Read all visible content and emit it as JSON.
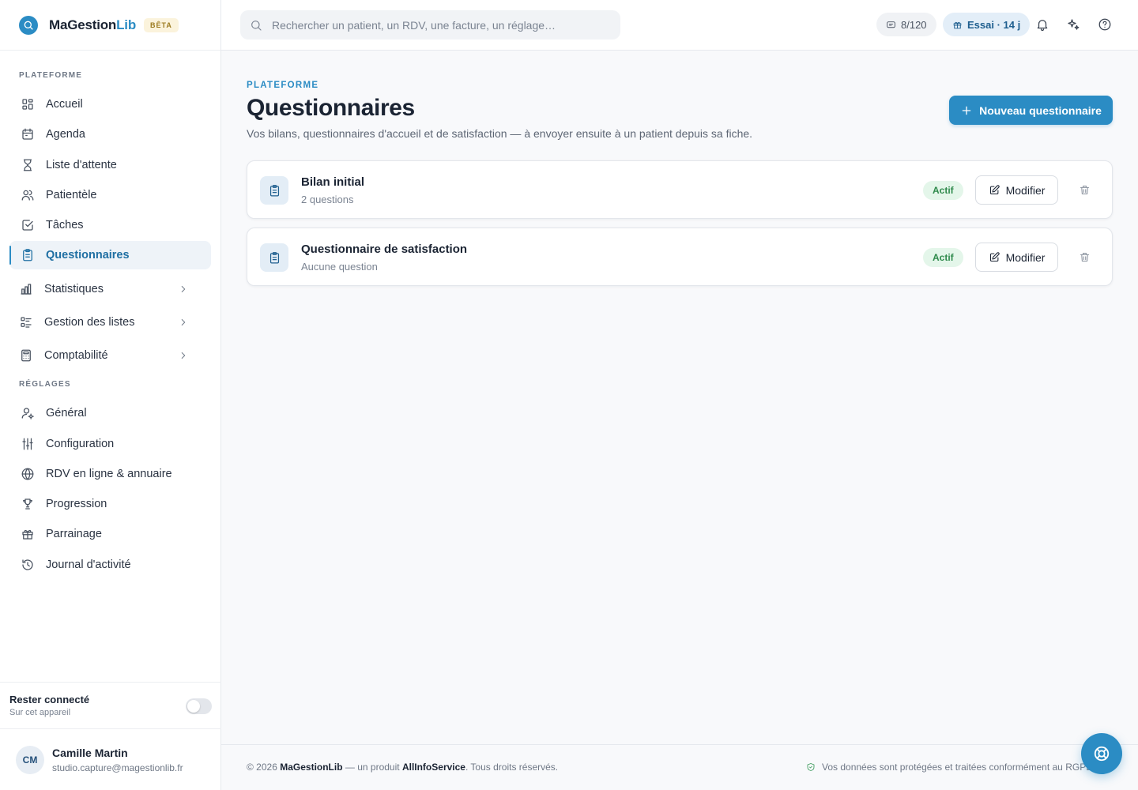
{
  "brand": {
    "name_main": "MaGestion",
    "name_accent": "Lib",
    "badge": "BÊTA"
  },
  "sidebar": {
    "sections": {
      "platform": "PLATEFORME",
      "settings": "RÉGLAGES"
    },
    "platform_items": [
      {
        "label": "Accueil",
        "icon": "grid-icon"
      },
      {
        "label": "Agenda",
        "icon": "calendar-icon"
      },
      {
        "label": "Liste d'attente",
        "icon": "hourglass-icon"
      },
      {
        "label": "Patientèle",
        "icon": "users-icon"
      },
      {
        "label": "Tâches",
        "icon": "checkbox-icon"
      },
      {
        "label": "Questionnaires",
        "icon": "clipboard-icon",
        "active": true
      },
      {
        "label": "Statistiques",
        "icon": "bar-chart-icon",
        "expandable": true
      },
      {
        "label": "Gestion des listes",
        "icon": "list-icon",
        "expandable": true
      },
      {
        "label": "Comptabilité",
        "icon": "calculator-icon",
        "expandable": true
      }
    ],
    "settings_items": [
      {
        "label": "Général",
        "icon": "user-gear-icon"
      },
      {
        "label": "Configuration",
        "icon": "sliders-icon"
      },
      {
        "label": "RDV en ligne & annuaire",
        "icon": "globe-icon"
      },
      {
        "label": "Progression",
        "icon": "trophy-icon"
      },
      {
        "label": "Parrainage",
        "icon": "gift-icon"
      },
      {
        "label": "Journal d'activité",
        "icon": "history-icon"
      }
    ],
    "stay_connected": {
      "title": "Rester connecté",
      "subtitle": "Sur cet appareil",
      "enabled": false
    },
    "user": {
      "initials": "CM",
      "name": "Camille Martin",
      "email": "studio.capture@magestionlib.fr"
    }
  },
  "topbar": {
    "search_placeholder": "Rechercher un patient, un RDV, une facture, un réglage…",
    "sms_counter": "8/120",
    "trial": "Essai · 14 j"
  },
  "page": {
    "eyebrow": "PLATEFORME",
    "title": "Questionnaires",
    "subtitle": "Vos bilans, questionnaires d'accueil et de satisfaction — à envoyer ensuite à un patient depuis sa fiche.",
    "new_button": "Nouveau questionnaire"
  },
  "questionnaires": [
    {
      "title": "Bilan initial",
      "subtitle": "2 questions",
      "status": "Actif",
      "edit_label": "Modifier"
    },
    {
      "title": "Questionnaire de satisfaction",
      "subtitle": "Aucune question",
      "status": "Actif",
      "edit_label": "Modifier"
    }
  ],
  "footer": {
    "copyright": "© 2026",
    "brand": "MaGestionLib",
    "middle": " — un produit ",
    "company": "AllInfoService",
    "rights": ". Tous droits réservés.",
    "security": "Vos données sont protégées et traitées conformément au RGPD."
  },
  "colors": {
    "accent": "#2b8cc4",
    "active_badge_bg": "#e4f6ea",
    "active_badge_text": "#2f8a4c"
  }
}
